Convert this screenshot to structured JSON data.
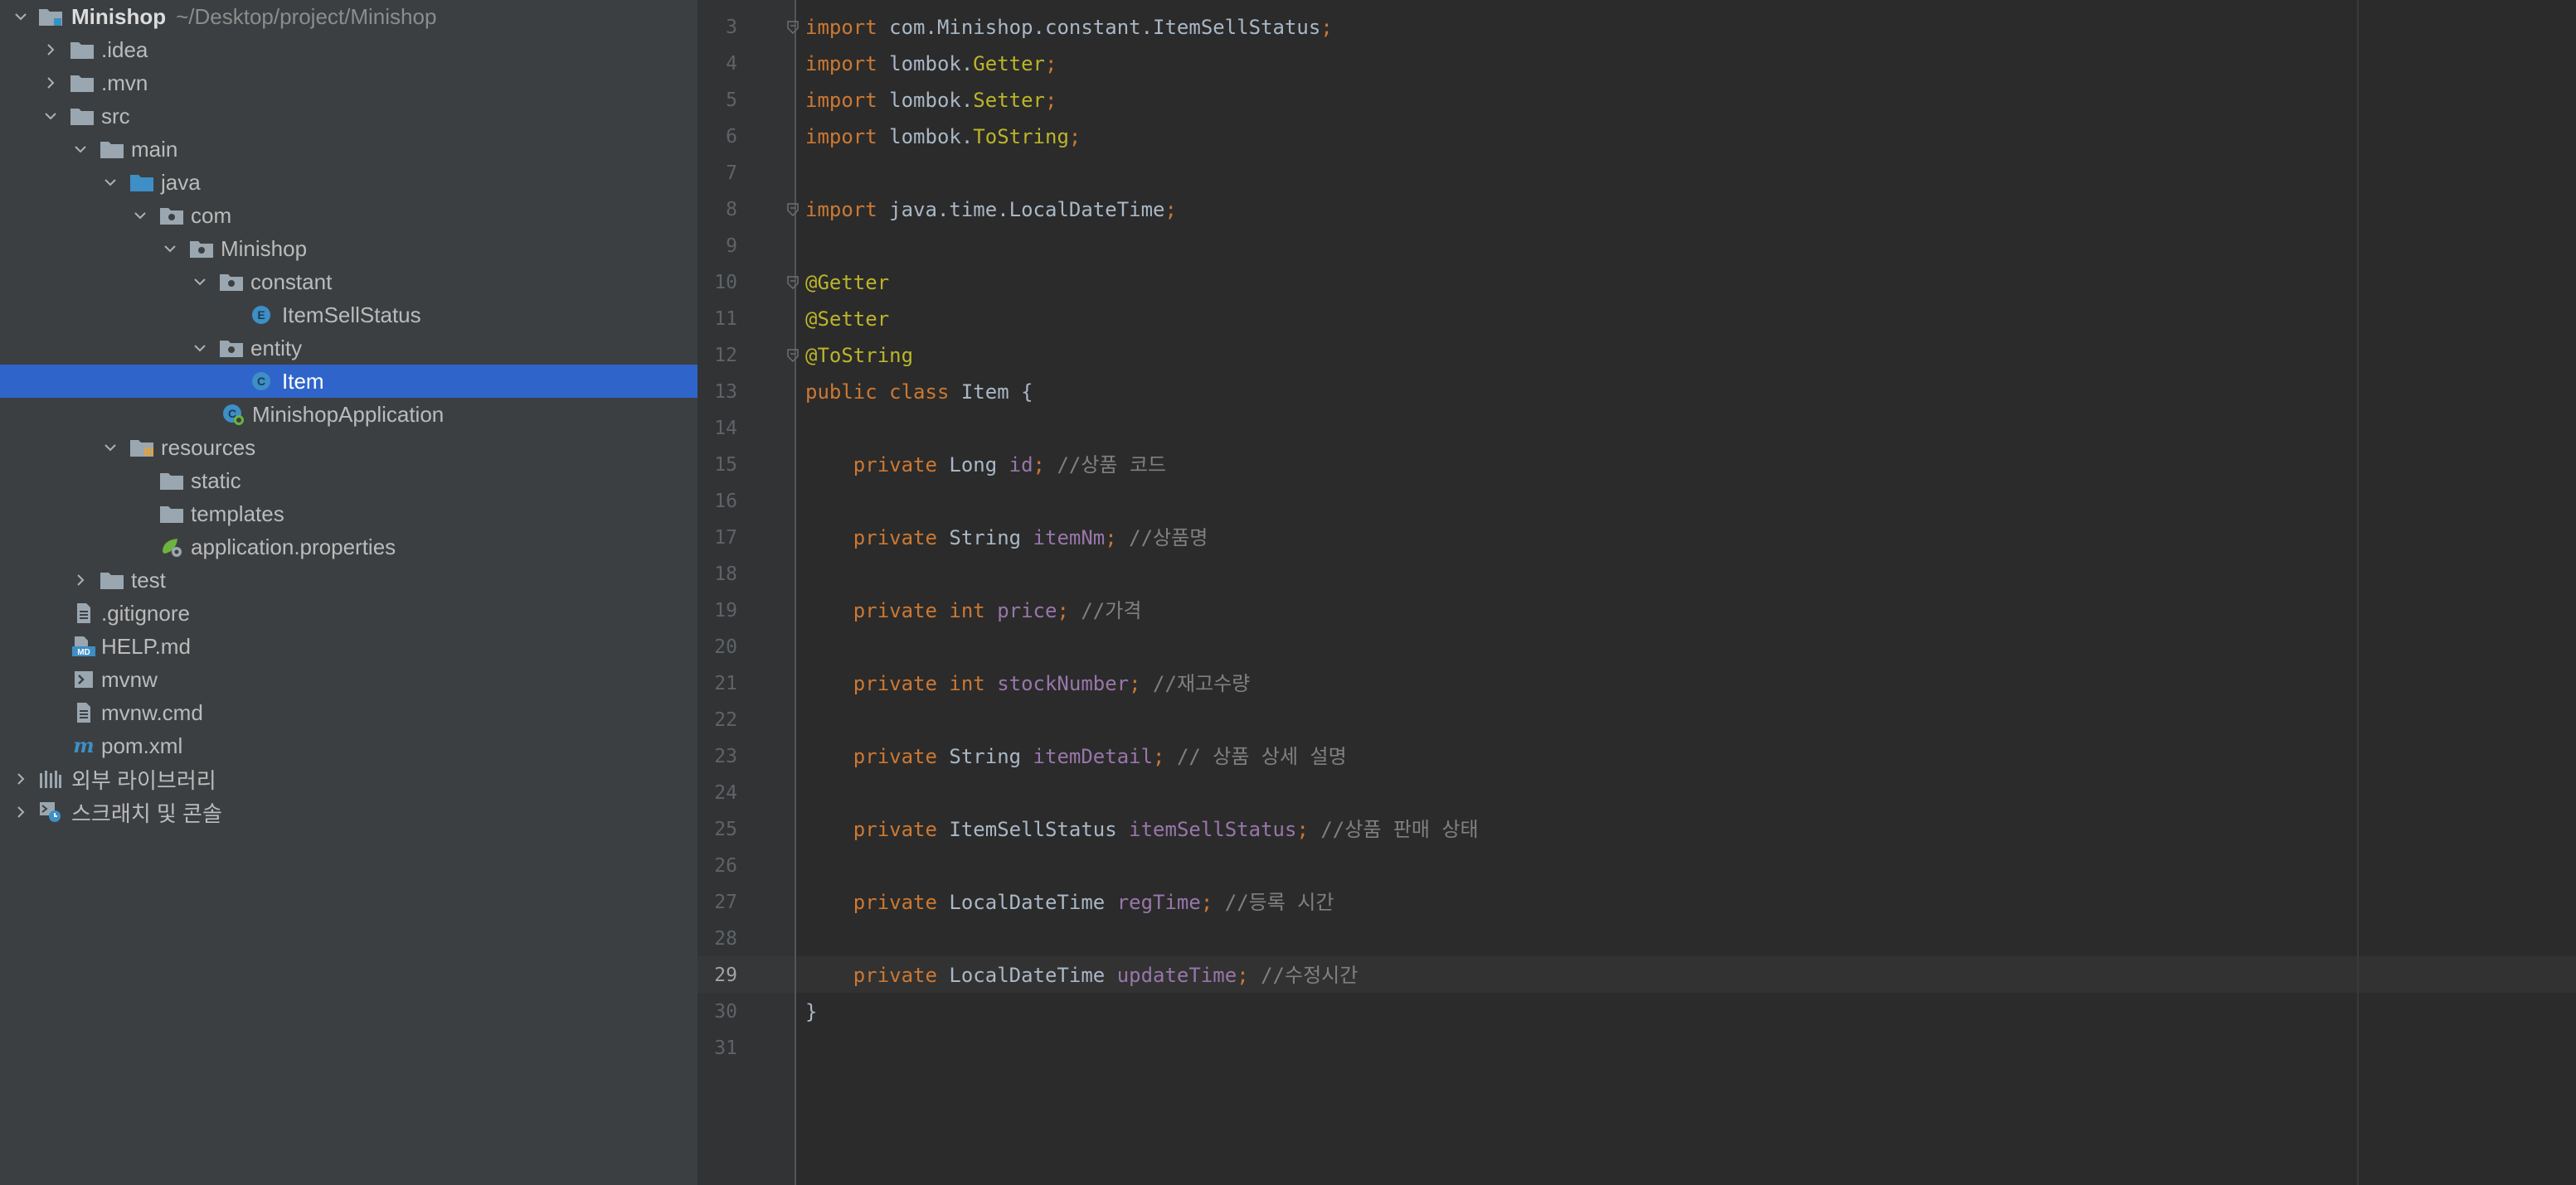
{
  "project_tree": {
    "root": {
      "name": "Minishop",
      "path": "~/Desktop/project/Minishop"
    },
    "items": [
      {
        "label": "Minishop",
        "icon": "project-folder-icon",
        "expanded": true
      },
      {
        "label": ".idea",
        "icon": "folder-icon",
        "expanded": false
      },
      {
        "label": ".mvn",
        "icon": "folder-icon",
        "expanded": false
      },
      {
        "label": "src",
        "icon": "folder-icon",
        "expanded": true
      },
      {
        "label": "main",
        "icon": "folder-icon",
        "expanded": true
      },
      {
        "label": "java",
        "icon": "source-folder-icon",
        "expanded": true
      },
      {
        "label": "com",
        "icon": "package-icon",
        "expanded": true
      },
      {
        "label": "Minishop",
        "icon": "package-icon",
        "expanded": true
      },
      {
        "label": "constant",
        "icon": "package-icon",
        "expanded": true
      },
      {
        "label": "ItemSellStatus",
        "icon": "enum-icon"
      },
      {
        "label": "entity",
        "icon": "package-icon",
        "expanded": true
      },
      {
        "label": "Item",
        "icon": "class-icon",
        "selected": true
      },
      {
        "label": "MinishopApplication",
        "icon": "spring-boot-app-icon"
      },
      {
        "label": "resources",
        "icon": "resources-folder-icon",
        "expanded": true
      },
      {
        "label": "static",
        "icon": "folder-icon"
      },
      {
        "label": "templates",
        "icon": "folder-icon"
      },
      {
        "label": "application.properties",
        "icon": "spring-properties-icon"
      },
      {
        "label": "test",
        "icon": "folder-icon",
        "expanded": false
      },
      {
        "label": ".gitignore",
        "icon": "text-file-icon"
      },
      {
        "label": "HELP.md",
        "icon": "markdown-file-icon"
      },
      {
        "label": "mvnw",
        "icon": "shell-script-icon"
      },
      {
        "label": "mvnw.cmd",
        "icon": "text-file-icon"
      },
      {
        "label": "pom.xml",
        "icon": "maven-icon"
      },
      {
        "label": "외부 라이브러리",
        "icon": "libraries-icon",
        "expanded": false
      },
      {
        "label": "스크래치 및 콘솔",
        "icon": "scratches-icon",
        "expanded": false
      }
    ]
  },
  "editor": {
    "current_line": "29",
    "lines": [
      {
        "n": "3",
        "fold": true,
        "tokens": [
          [
            "import",
            "kw"
          ],
          [
            " com.Minishop.constant.ItemSellStatus",
            "plain"
          ],
          [
            ";",
            "kw"
          ]
        ]
      },
      {
        "n": "4",
        "tokens": [
          [
            "import",
            "kw"
          ],
          [
            " lombok.",
            "plain"
          ],
          [
            "Getter",
            "annot"
          ],
          [
            ";",
            "kw"
          ]
        ]
      },
      {
        "n": "5",
        "tokens": [
          [
            "import",
            "kw"
          ],
          [
            " lombok.",
            "plain"
          ],
          [
            "Setter",
            "annot"
          ],
          [
            ";",
            "kw"
          ]
        ]
      },
      {
        "n": "6",
        "tokens": [
          [
            "import",
            "kw"
          ],
          [
            " lombok.",
            "plain"
          ],
          [
            "ToString",
            "annot"
          ],
          [
            ";",
            "kw"
          ]
        ]
      },
      {
        "n": "7",
        "tokens": []
      },
      {
        "n": "8",
        "fold": true,
        "tokens": [
          [
            "import",
            "kw"
          ],
          [
            " java.time.LocalDateTime",
            "plain"
          ],
          [
            ";",
            "kw"
          ]
        ]
      },
      {
        "n": "9",
        "tokens": []
      },
      {
        "n": "10",
        "fold": true,
        "tokens": [
          [
            "@Getter",
            "annot"
          ]
        ]
      },
      {
        "n": "11",
        "tokens": [
          [
            "@Setter",
            "annot"
          ]
        ]
      },
      {
        "n": "12",
        "fold": true,
        "tokens": [
          [
            "@ToString",
            "annot"
          ]
        ]
      },
      {
        "n": "13",
        "tokens": [
          [
            "public class ",
            "kw"
          ],
          [
            "Item {",
            "plain"
          ]
        ]
      },
      {
        "n": "14",
        "tokens": []
      },
      {
        "n": "15",
        "tokens": [
          [
            "    private ",
            "kw"
          ],
          [
            "Long ",
            "plain"
          ],
          [
            "id",
            "field"
          ],
          [
            "; ",
            "kw"
          ],
          [
            "//상품 코드",
            "comment"
          ]
        ]
      },
      {
        "n": "16",
        "tokens": []
      },
      {
        "n": "17",
        "tokens": [
          [
            "    private ",
            "kw"
          ],
          [
            "String ",
            "plain"
          ],
          [
            "itemNm",
            "field"
          ],
          [
            "; ",
            "kw"
          ],
          [
            "//상품명",
            "comment"
          ]
        ]
      },
      {
        "n": "18",
        "tokens": []
      },
      {
        "n": "19",
        "tokens": [
          [
            "    private int ",
            "kw"
          ],
          [
            "price",
            "field"
          ],
          [
            "; ",
            "kw"
          ],
          [
            "//가격",
            "comment"
          ]
        ]
      },
      {
        "n": "20",
        "tokens": []
      },
      {
        "n": "21",
        "tokens": [
          [
            "    private int ",
            "kw"
          ],
          [
            "stockNumber",
            "field"
          ],
          [
            "; ",
            "kw"
          ],
          [
            "//재고수량",
            "comment"
          ]
        ]
      },
      {
        "n": "22",
        "tokens": []
      },
      {
        "n": "23",
        "tokens": [
          [
            "    private ",
            "kw"
          ],
          [
            "String ",
            "plain"
          ],
          [
            "itemDetail",
            "field"
          ],
          [
            "; ",
            "kw"
          ],
          [
            "// 상품 상세 설명",
            "comment"
          ]
        ]
      },
      {
        "n": "24",
        "tokens": []
      },
      {
        "n": "25",
        "tokens": [
          [
            "    private ",
            "kw"
          ],
          [
            "ItemSellStatus ",
            "plain"
          ],
          [
            "itemSellStatus",
            "field"
          ],
          [
            "; ",
            "kw"
          ],
          [
            "//상품 판매 상태",
            "comment"
          ]
        ]
      },
      {
        "n": "26",
        "tokens": []
      },
      {
        "n": "27",
        "tokens": [
          [
            "    private ",
            "kw"
          ],
          [
            "LocalDateTime ",
            "plain"
          ],
          [
            "regTime",
            "field"
          ],
          [
            "; ",
            "kw"
          ],
          [
            "//등록 시간",
            "comment"
          ]
        ]
      },
      {
        "n": "28",
        "tokens": []
      },
      {
        "n": "29",
        "tokens": [
          [
            "    private ",
            "kw"
          ],
          [
            "LocalDateTime ",
            "plain"
          ],
          [
            "updateTime",
            "field"
          ],
          [
            "; ",
            "kw"
          ],
          [
            "//수정시간",
            "comment"
          ]
        ]
      },
      {
        "n": "30",
        "tokens": [
          [
            "}",
            "plain"
          ]
        ]
      },
      {
        "n": "31",
        "tokens": []
      }
    ]
  },
  "colors": {
    "sidebar_bg": "#3c3f41",
    "editor_bg": "#2b2b2b",
    "selection": "#2f65ca",
    "keyword": "#cc7832",
    "annotation": "#bbb529",
    "field": "#9876aa",
    "comment": "#808080",
    "plain": "#a9b7c6"
  }
}
